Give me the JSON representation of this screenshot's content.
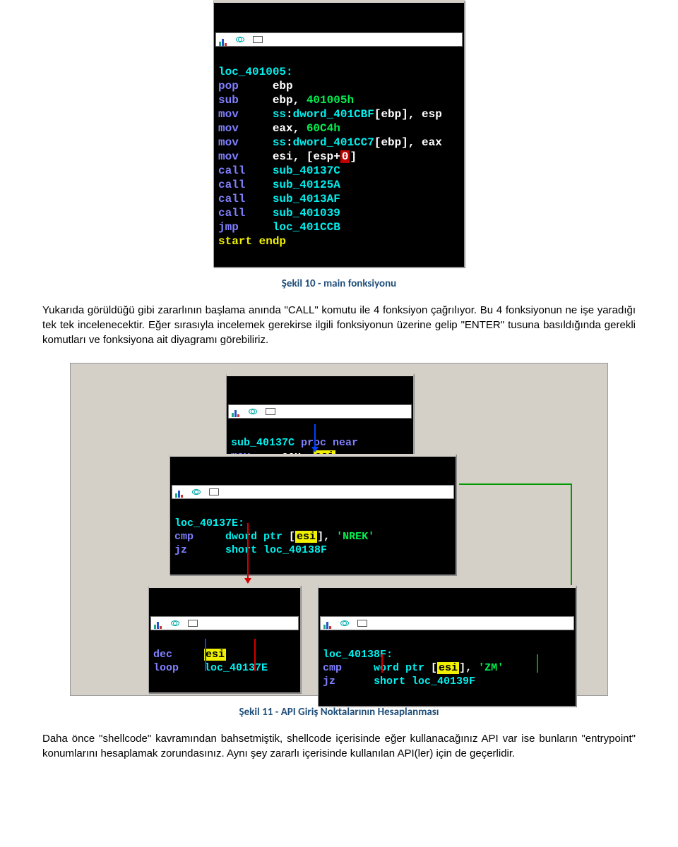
{
  "block1": {
    "label": "loc_401005:",
    "lines": [
      {
        "mn": "pop",
        "op": [
          {
            "t": "ebp",
            "c": "c-white"
          }
        ]
      },
      {
        "mn": "sub",
        "op": [
          {
            "t": "ebp, ",
            "c": "c-white"
          },
          {
            "t": "401005h",
            "c": "c-green"
          }
        ]
      },
      {
        "mn": "mov",
        "op": [
          {
            "t": "ss",
            "c": "c-cyan"
          },
          {
            "t": ":",
            "c": "c-white"
          },
          {
            "t": "dword_401CBF",
            "c": "c-cyan"
          },
          {
            "t": "[",
            "c": "c-white"
          },
          {
            "t": "ebp",
            "c": "c-white"
          },
          {
            "t": "], ",
            "c": "c-white"
          },
          {
            "t": "esp",
            "c": "c-white"
          }
        ]
      },
      {
        "mn": "mov",
        "op": [
          {
            "t": "eax",
            "c": "c-white"
          },
          {
            "t": ", ",
            "c": "c-white"
          },
          {
            "t": "60C4h",
            "c": "c-green"
          }
        ]
      },
      {
        "mn": "mov",
        "op": [
          {
            "t": "ss",
            "c": "c-cyan"
          },
          {
            "t": ":",
            "c": "c-white"
          },
          {
            "t": "dword_401CC7",
            "c": "c-cyan"
          },
          {
            "t": "[",
            "c": "c-white"
          },
          {
            "t": "ebp",
            "c": "c-white"
          },
          {
            "t": "], ",
            "c": "c-white"
          },
          {
            "t": "eax",
            "c": "c-white"
          }
        ]
      },
      {
        "mn": "mov",
        "op": [
          {
            "t": "esi",
            "c": "c-white"
          },
          {
            "t": ", [",
            "c": "c-white"
          },
          {
            "t": "esp",
            "c": "c-white"
          },
          {
            "t": "+",
            "c": "c-white"
          },
          {
            "t": "0",
            "c": "hl-red"
          },
          {
            "t": "]",
            "c": "c-white"
          }
        ]
      },
      {
        "mn": "call",
        "op": [
          {
            "t": "sub_40137C",
            "c": "c-cyan"
          }
        ]
      },
      {
        "mn": "call",
        "op": [
          {
            "t": "sub_40125A",
            "c": "c-cyan"
          }
        ]
      },
      {
        "mn": "call",
        "op": [
          {
            "t": "sub_4013AF",
            "c": "c-cyan"
          }
        ]
      },
      {
        "mn": "call",
        "op": [
          {
            "t": "sub_401039",
            "c": "c-cyan"
          }
        ]
      },
      {
        "mn": "jmp",
        "op": [
          {
            "t": "loc_401CCB",
            "c": "c-cyan"
          }
        ]
      }
    ],
    "end": "start endp"
  },
  "caption1": "Şekil 10 - main fonksiyonu",
  "para1": "Yukarıda görüldüğü gibi zararlının başlama anında \"CALL\" komutu ile 4 fonksiyon çağrılıyor. Bu 4 fonksiyonun ne işe yaradığı tek tek incelenecektir. Eğer sırasıyla incelemek gerekirse ilgili fonksiyonun üzerine gelip \"ENTER\" tusuna basıldığında gerekli komutları ve fonksiyona ait diyagramı görebiliriz.",
  "diag": {
    "b1": {
      "head": "sub_40137C proc near",
      "mn": "mov",
      "op": [
        {
          "t": "ecx, ",
          "c": "c-white"
        },
        {
          "t": "esi",
          "c": "hl-yel"
        }
      ]
    },
    "b2": {
      "label": "loc_40137E:",
      "lines": [
        {
          "mn": "cmp",
          "op": [
            {
              "t": "dword ptr",
              "c": "c-cyan"
            },
            {
              "t": " [",
              "c": "c-white"
            },
            {
              "t": "esi",
              "c": "hl-yel"
            },
            {
              "t": "], ",
              "c": "c-white"
            },
            {
              "t": "'NREK'",
              "c": "c-green"
            }
          ]
        },
        {
          "mn": "jz",
          "op": [
            {
              "t": "short ",
              "c": "c-cyan"
            },
            {
              "t": "loc_40138F",
              "c": "c-cyan"
            }
          ]
        }
      ]
    },
    "b3": {
      "lines": [
        {
          "mn": "dec",
          "op": [
            {
              "t": "esi",
              "c": "hl-yel"
            }
          ]
        },
        {
          "mn": "loop",
          "op": [
            {
              "t": "loc_40137E",
              "c": "c-cyan"
            }
          ]
        }
      ]
    },
    "b4": {
      "label": "loc_40138F:",
      "lines": [
        {
          "mn": "cmp",
          "op": [
            {
              "t": "word ptr",
              "c": "c-cyan"
            },
            {
              "t": " [",
              "c": "c-white"
            },
            {
              "t": "esi",
              "c": "hl-yel"
            },
            {
              "t": "], ",
              "c": "c-white"
            },
            {
              "t": "'ZM'",
              "c": "c-green"
            }
          ]
        },
        {
          "mn": "jz",
          "op": [
            {
              "t": "short ",
              "c": "c-cyan"
            },
            {
              "t": "loc_40139F",
              "c": "c-cyan"
            }
          ]
        }
      ]
    }
  },
  "caption2": "Şekil 11 - API Giriş Noktalarının Hesaplanması",
  "para2": "Daha önce \"shellcode\" kavramından bahsetmiştik, shellcode içerisinde eğer kullanacağınız API var ise bunların \"entrypoint\" konumlarını hesaplamak zorundasınız. Aynı şey zararlı içerisinde kullanılan API(ler) için de geçerlidir."
}
